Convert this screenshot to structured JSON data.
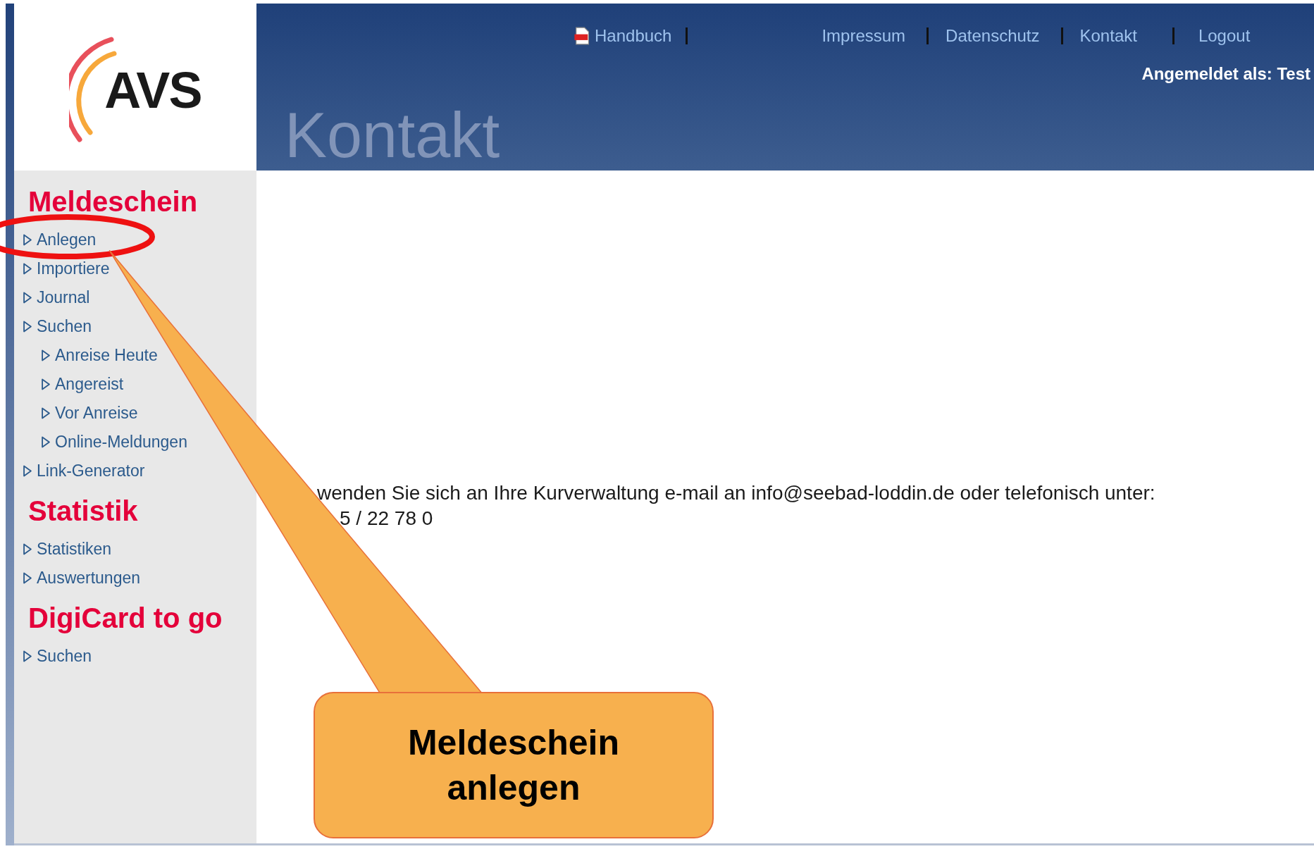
{
  "logo": {
    "text": "AVS"
  },
  "header": {
    "links": [
      {
        "label": "Handbuch",
        "kind": "pdf"
      },
      {
        "label": "Impressum",
        "kind": "plain"
      },
      {
        "label": "Datenschutz",
        "kind": "plain"
      },
      {
        "label": "Kontakt",
        "kind": "plain"
      },
      {
        "label": "Logout",
        "kind": "plain"
      }
    ],
    "user": "Angemeldet als: Test",
    "title": "Kontakt"
  },
  "sidebar": {
    "sections": [
      {
        "title": "Meldeschein",
        "items": [
          {
            "label": "Anlegen"
          },
          {
            "label": "Importiere"
          },
          {
            "label": "Journal"
          },
          {
            "label": "Suchen",
            "children": [
              {
                "label": "Anreise Heute"
              },
              {
                "label": "Angereist"
              },
              {
                "label": "Vor Anreise"
              },
              {
                "label": "Online-Meldungen"
              }
            ]
          },
          {
            "label": "Link-Generator"
          }
        ]
      },
      {
        "title": "Statistik",
        "items": [
          {
            "label": "Statistiken"
          },
          {
            "label": "Auswertungen"
          }
        ]
      },
      {
        "title": "DigiCard to go",
        "items": [
          {
            "label": "Suchen"
          }
        ]
      }
    ]
  },
  "content": {
    "lines": [
      "wenden Sie sich an Ihre Kurverwaltung e-mail an info@seebad-loddin.de oder telefonisch unter:",
      "5 / 22 78 0"
    ]
  },
  "callout": {
    "text": "Meldeschein anlegen"
  }
}
